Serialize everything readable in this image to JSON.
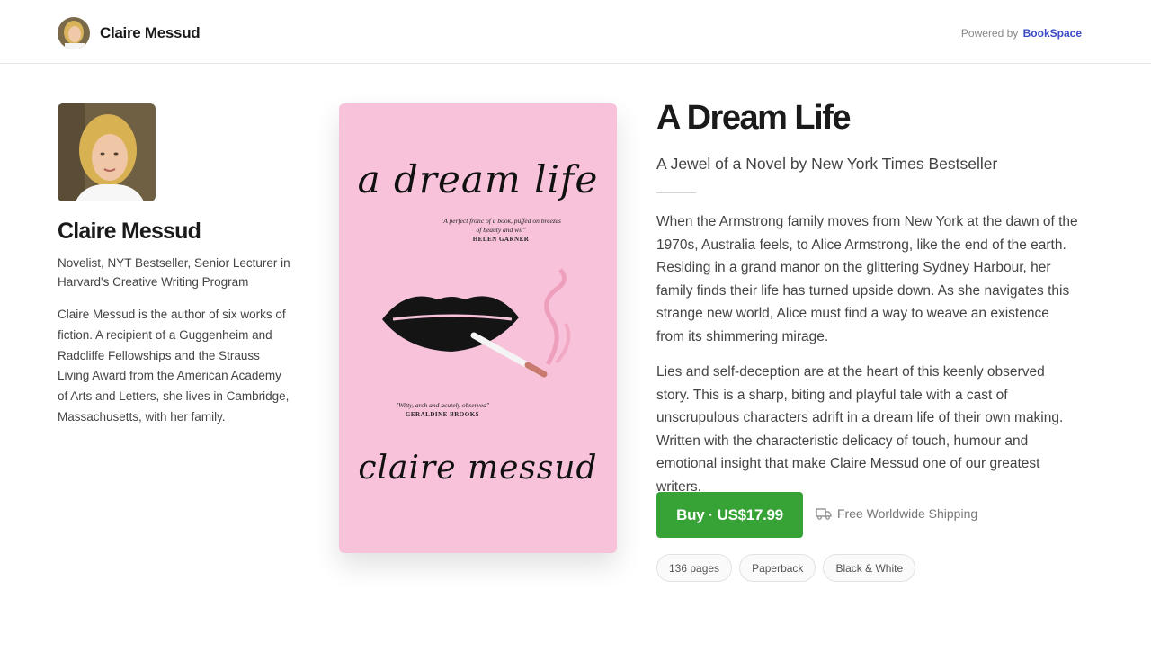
{
  "header": {
    "author_name": "Claire Messud",
    "powered_by_label": "Powered by",
    "brand": "BookSpace"
  },
  "author": {
    "name": "Claire Messud",
    "tagline": "Novelist, NYT Bestseller, Senior Lecturer in Harvard's Creative Writing Program",
    "bio": "Claire Messud is the author of six works of fiction. A recipient of a Guggenheim and Radcliffe Fellowships and the Strauss Living Award from the American Academy of Arts and Letters, she lives in Cambridge, Massachusetts, with her family."
  },
  "cover": {
    "title": "a dream life",
    "quote": "\"A perfect frolic of a book, puffed on breezes of beauty and wit\"",
    "quote_source": "HELEN GARNER",
    "quote2": "\"Witty, arch and acutely observed\"",
    "quote2_source": "GERALDINE BROOKS",
    "author": "claire messud",
    "background_color": "#f7c2da"
  },
  "book": {
    "title": "A Dream Life",
    "subtitle": "A Jewel of a Novel by New York Times Bestseller",
    "description_1": "When the Armstrong family moves from New York at the dawn of the 1970s, Australia feels, to Alice Armstrong, like the end of the earth. Residing in a grand manor on the glittering Sydney Harbour, her family finds their life has turned upside down. As she navigates this strange new world, Alice must find a way to weave an existence from its shimmering mirage.",
    "description_2": "Lies and self-deception are at the heart of this keenly observed story. This is a sharp, biting and playful tale with a cast of unscrupulous characters adrift in a dream life of their own making. Written with the characteristic delicacy of touch, humour and emotional insight that make Claire Messud one of our greatest writers.",
    "buy_label": "Buy · US$17.99",
    "shipping": "Free Worldwide Shipping",
    "shipping_icon": "truck-icon",
    "tags": [
      "136 pages",
      "Paperback",
      "Black & White"
    ]
  },
  "colors": {
    "buy_button": "#37a236",
    "brand_link": "#3b4bc8"
  }
}
